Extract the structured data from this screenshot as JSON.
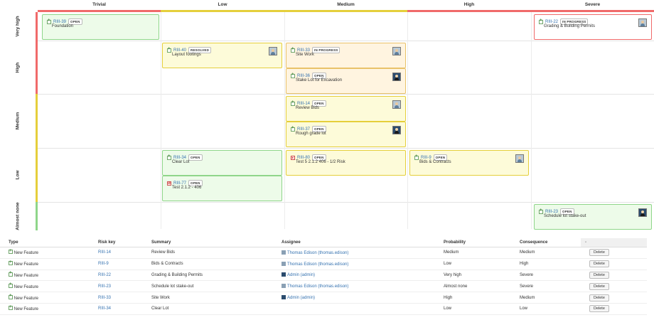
{
  "matrix": {
    "columns": [
      "Trivial",
      "Low",
      "Medium",
      "High",
      "Severe"
    ],
    "rows": [
      "Very high",
      "High",
      "Medium",
      "Low",
      "Almost none"
    ]
  },
  "cards": [
    {
      "key": "RIII-39",
      "status": "OPEN",
      "summary": "Foundation",
      "type": "new-feature",
      "avatar": "none"
    },
    {
      "key": "RIII-22",
      "status": "IN PROGRESS",
      "summary": "Grading & Building Permits",
      "type": "new-feature",
      "avatar": "thomas"
    },
    {
      "key": "RIII-40",
      "status": "RESOLVED",
      "summary": "Layout footings",
      "type": "new-feature",
      "avatar": "thomas"
    },
    {
      "key": "RIII-33",
      "status": "IN PROGRESS",
      "summary": "Site Work",
      "type": "new-feature",
      "avatar": "thomas"
    },
    {
      "key": "RIII-36",
      "status": "OPEN",
      "summary": "Stake Lot for Excavation",
      "type": "new-feature",
      "avatar": "admin"
    },
    {
      "key": "RIII-14",
      "status": "OPEN",
      "summary": "Review Bids",
      "type": "new-feature",
      "avatar": "thomas"
    },
    {
      "key": "RIII-37",
      "status": "OPEN",
      "summary": "Rough grade lot",
      "type": "new-feature",
      "avatar": "admin"
    },
    {
      "key": "RIII-34",
      "status": "OPEN",
      "summary": "Clear Lot",
      "type": "new-feature",
      "avatar": "none"
    },
    {
      "key": "RIII-77",
      "status": "OPEN",
      "summary": "Test 2.1.2 - 406",
      "type": "improvement",
      "avatar": "none"
    },
    {
      "key": "RIII-80",
      "status": "OPEN",
      "summary": "Test 5 2.1.2 406 - 1/2 Risk",
      "type": "bug",
      "avatar": "none"
    },
    {
      "key": "RIII-9",
      "status": "OPEN",
      "summary": "Bids & Contracts",
      "type": "new-feature",
      "avatar": "thomas"
    },
    {
      "key": "RIII-23",
      "status": "OPEN",
      "summary": "Schedule lot stake-out",
      "type": "new-feature",
      "avatar": "admin"
    }
  ],
  "table": {
    "headers": [
      "Type",
      "Risk key",
      "Summary",
      "Assignee",
      "Probability",
      "Consequence",
      "-"
    ],
    "delete_label": "Delete",
    "rows": [
      {
        "type": "New Feature",
        "key": "RIII-14",
        "summary": "Review Bids",
        "assignee": "Thomas Edison (thomas.edison)",
        "probability": "Medium",
        "consequence": "Medium"
      },
      {
        "type": "New Feature",
        "key": "RIII-9",
        "summary": "Bids & Contracts",
        "assignee": "Thomas Edison (thomas.edison)",
        "probability": "Low",
        "consequence": "High"
      },
      {
        "type": "New Feature",
        "key": "RIII-22",
        "summary": "Grading & Building Permits",
        "assignee": "Admin (admin)",
        "probability": "Very high",
        "consequence": "Severe"
      },
      {
        "type": "New Feature",
        "key": "RIII-23",
        "summary": "Schedule lot stake-out",
        "assignee": "Thomas Edison (thomas.edison)",
        "probability": "Almost none",
        "consequence": "Severe"
      },
      {
        "type": "New Feature",
        "key": "RIII-33",
        "summary": "Site Work",
        "assignee": "Admin (admin)",
        "probability": "High",
        "consequence": "Medium"
      },
      {
        "type": "New Feature",
        "key": "RIII-34",
        "summary": "Clear Lot",
        "assignee": "",
        "probability": "Low",
        "consequence": "Low"
      }
    ]
  },
  "colors": {
    "risk_low": "#8fd68a",
    "risk_medium": "#e5cf3b",
    "risk_high": "#f06a6a",
    "link": "#3572b0"
  }
}
